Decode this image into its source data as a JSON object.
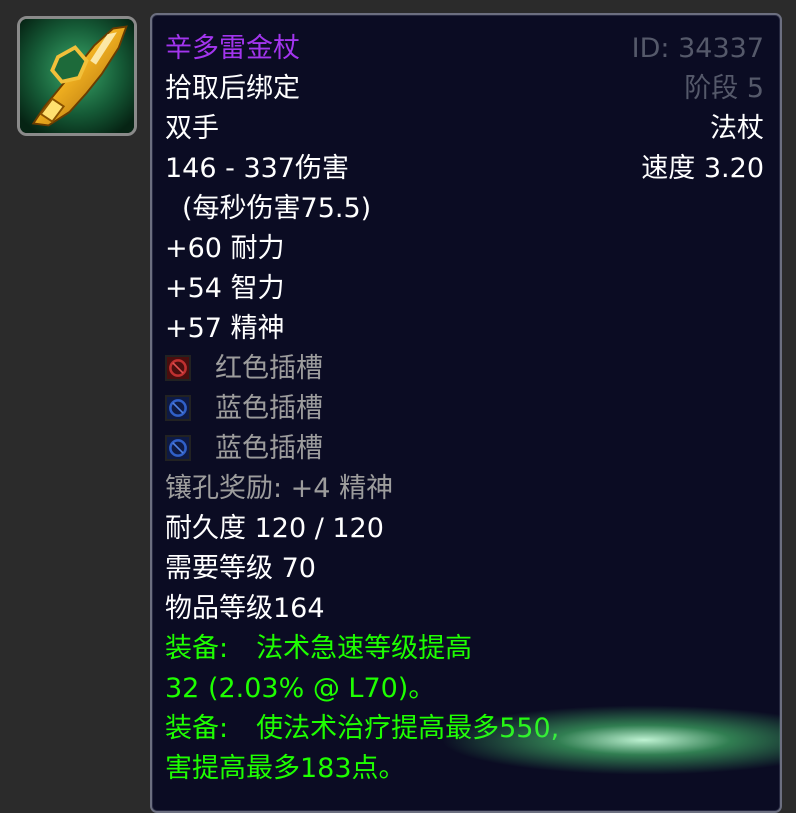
{
  "item": {
    "name": "辛多雷金杖",
    "id_text": "ID: 34337",
    "bind": "拾取后绑定",
    "phase": "阶段 5",
    "slot": "双手",
    "type": "法杖",
    "damage": "146 - 337伤害",
    "speed": "速度 3.20",
    "dps": "(每秒伤害75.5)",
    "stats": [
      "+60 耐力",
      "+54 智力",
      "+57 精神"
    ],
    "sockets": [
      {
        "label": "红色插槽",
        "color": "#b02020"
      },
      {
        "label": "蓝色插槽",
        "color": "#2a4fb0"
      },
      {
        "label": "蓝色插槽",
        "color": "#2a4fb0"
      }
    ],
    "socket_bonus": "镶孔奖励: +4 精神",
    "durability": "耐久度 120 / 120",
    "required_level": "需要等级 70",
    "item_level": "物品等级164",
    "equip": [
      {
        "prefix": "装备:",
        "text": "法术急速等级提高"
      },
      {
        "text": "32 (2.03% @ L70)。"
      },
      {
        "prefix": "装备:",
        "text": "使法术治疗提高最多550,"
      },
      {
        "text": "害提高最多183点。"
      }
    ]
  },
  "icon": "golden-staff-icon",
  "colors": {
    "epic": "#a335ee",
    "equip_green": "#1eff00",
    "socket_gray": "#9d9d9d",
    "background": "#0b0c23"
  }
}
